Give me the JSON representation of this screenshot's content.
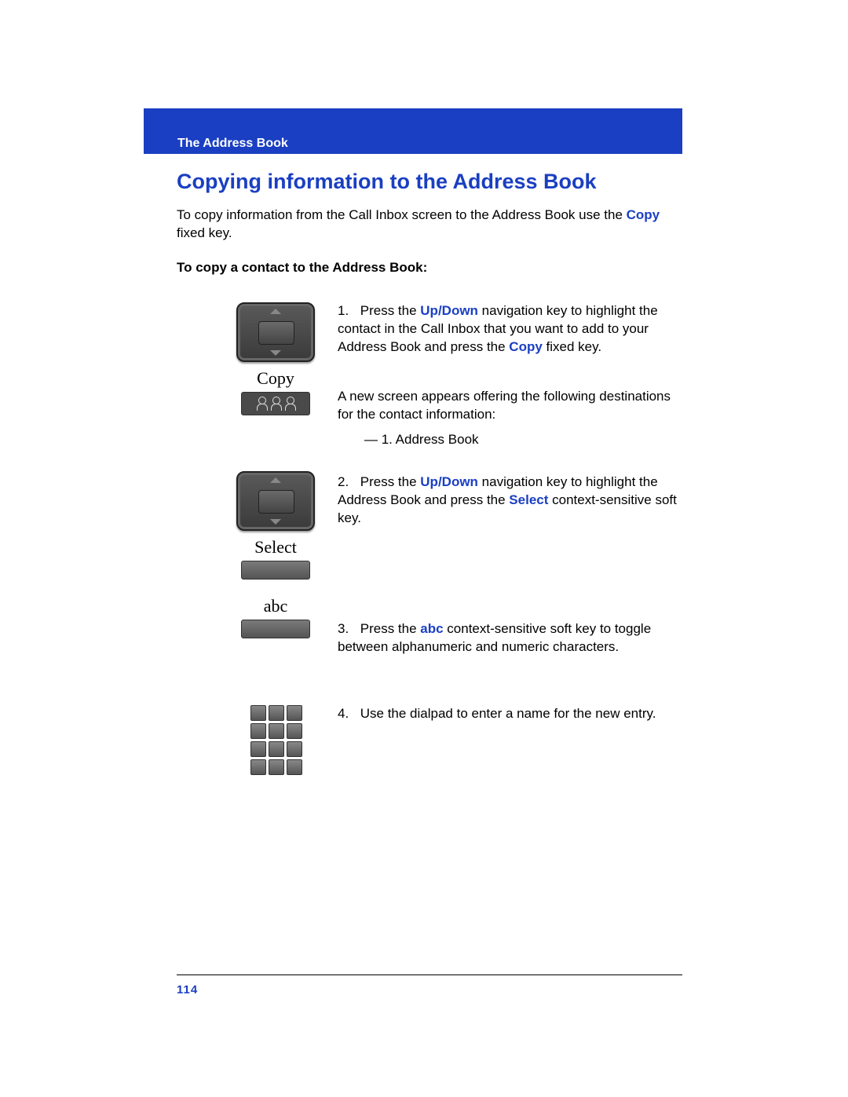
{
  "header": {
    "section": "The Address Book",
    "title": "Copying information to the Address Book"
  },
  "intro": {
    "pre": "To copy information from the Call Inbox screen to the Address Book use the ",
    "kw": "Copy",
    "post": " fixed key."
  },
  "subhead": "To copy a contact to the Address Book:",
  "icons": {
    "copy_label": "Copy",
    "select_label": "Select",
    "abc_label": "abc"
  },
  "steps": {
    "s1_num": "1.",
    "s1_a": "Press the ",
    "s1_kw1": "Up/Down",
    "s1_b": " navigation key to highlight the contact in the Call Inbox that you want to add to your Address Book and press the ",
    "s1_kw2": "Copy",
    "s1_c": " fixed key.",
    "s1_follow": "A new screen appears offering the following destinations for the contact information:",
    "s1_bullet": "—   1. Address Book",
    "s2_num": "2.",
    "s2_a": "Press the ",
    "s2_kw1": "Up/Down",
    "s2_b": " navigation key to highlight the Address Book and press the ",
    "s2_kw2": "Select",
    "s2_c": " context-sensitive soft key.",
    "s3_num": "3.",
    "s3_a": "Press the ",
    "s3_kw1": "abc",
    "s3_b": " context-sensitive soft key to toggle between alphanumeric and numeric characters.",
    "s4_num": "4.",
    "s4_a": "Use the dialpad to enter a name for the new entry."
  },
  "page_number": "114"
}
